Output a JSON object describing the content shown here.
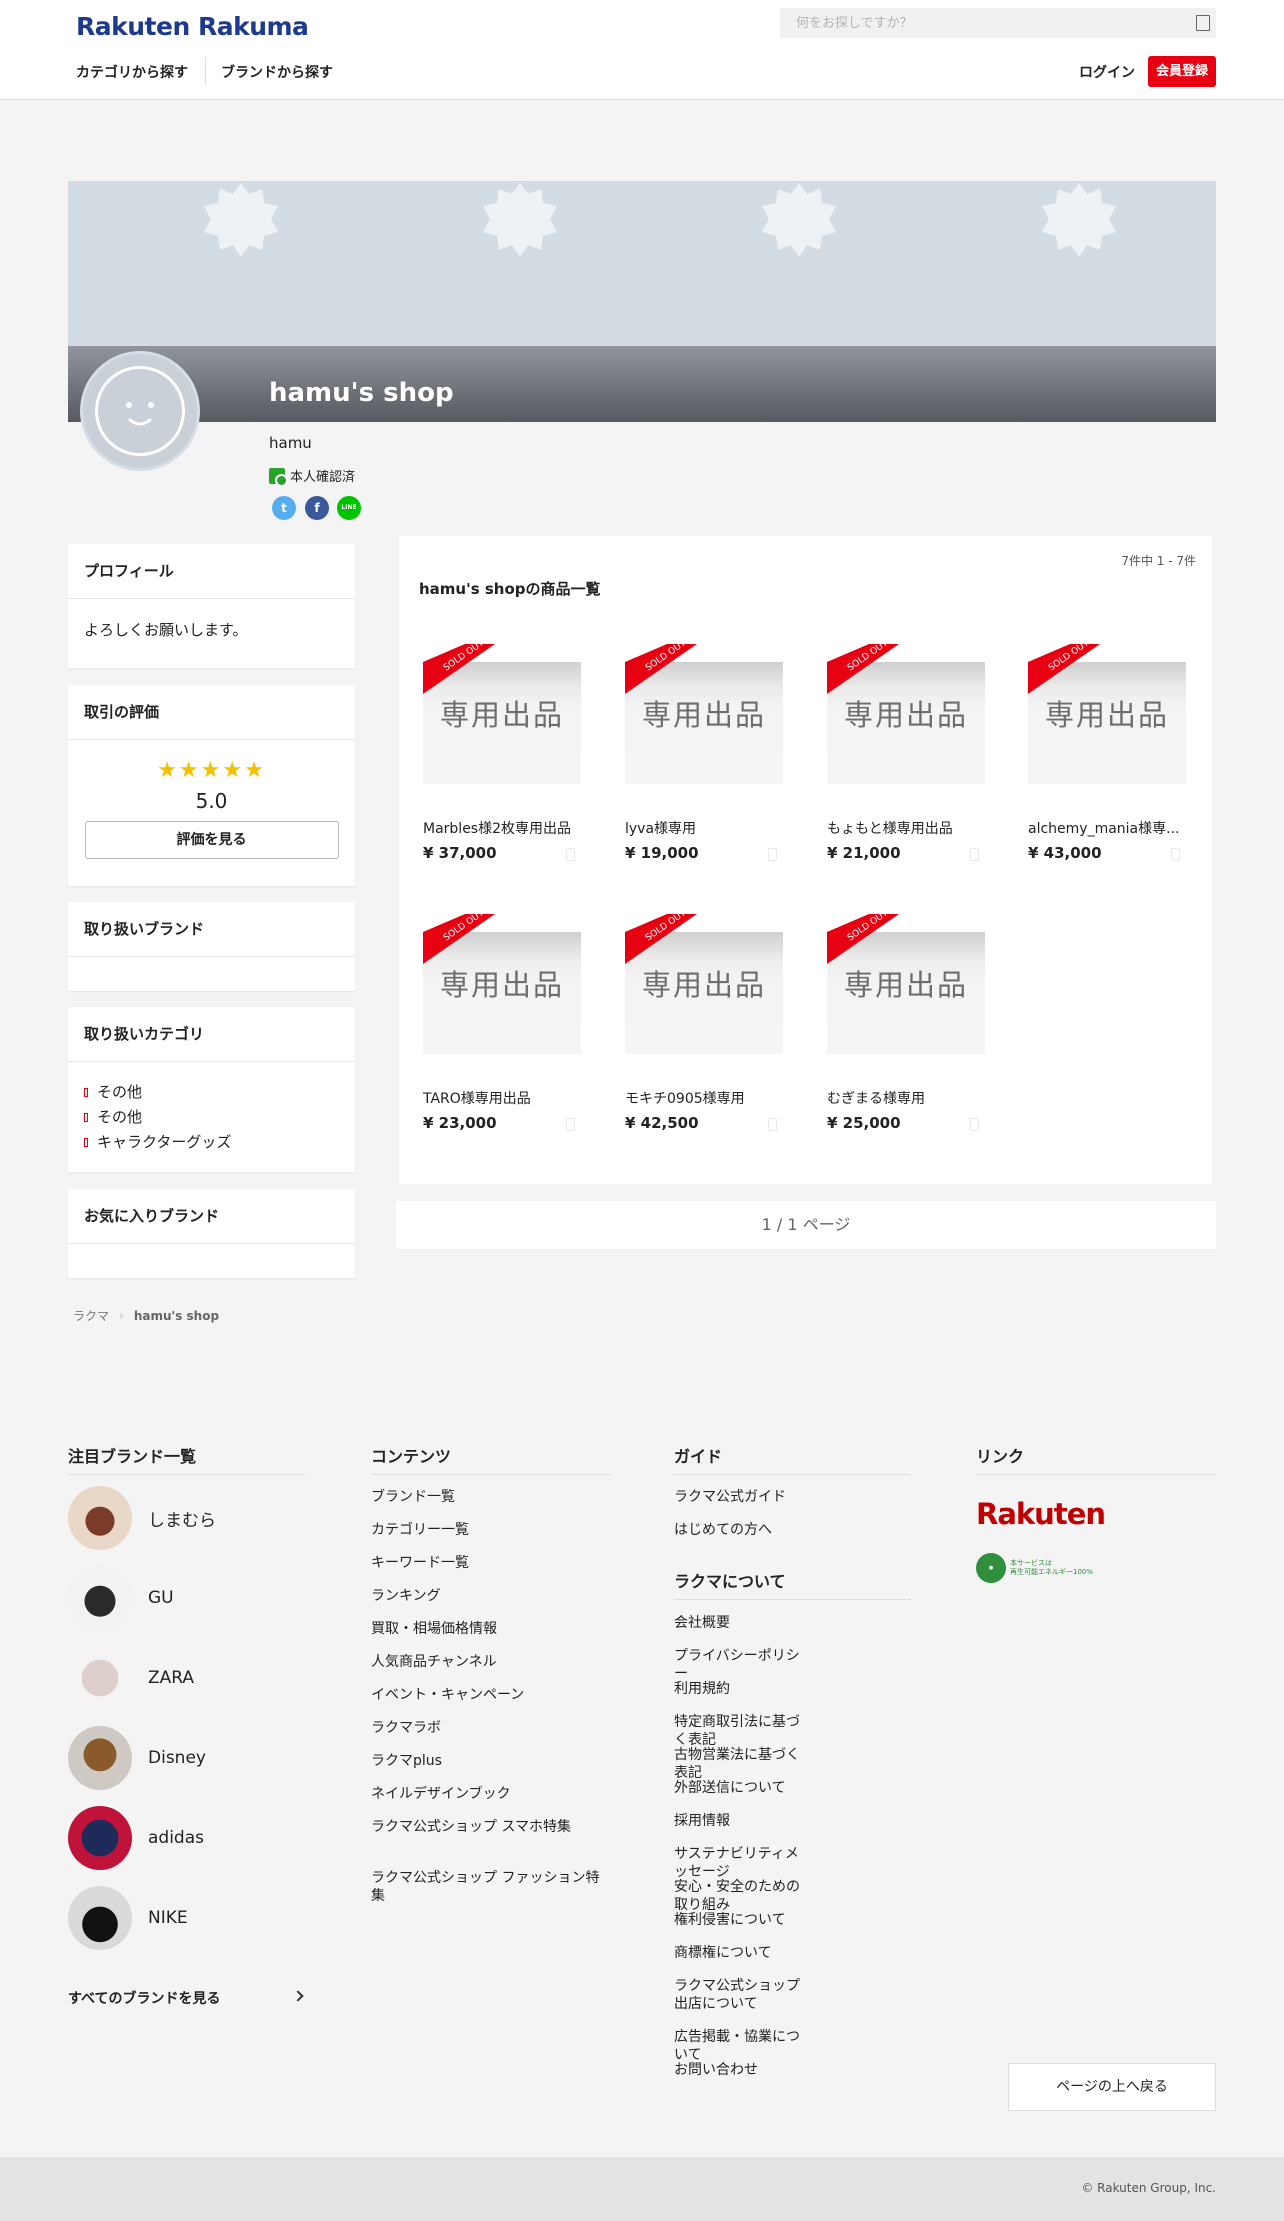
{
  "header": {
    "logo": "Rakuten Rakuma",
    "search_placeholder": "何をお探しですか？",
    "nav_category": "カテゴリから探す",
    "nav_brand": "ブランドから探す",
    "login": "ログイン",
    "register": "会員登録"
  },
  "shop": {
    "title": "hamu's shop",
    "owner": "hamu",
    "verified": "本人確認済"
  },
  "social": {
    "twitter": "t",
    "facebook": "f",
    "line": "LINE"
  },
  "sidebar": {
    "profile_title": "プロフィール",
    "profile_text": "よろしくお願いします。",
    "rating_title": "取引の評価",
    "rating_stars": "★★★★★",
    "rating_value": "5.0",
    "rating_button": "評価を見る",
    "brands_title": "取り扱いブランド",
    "categories_title": "取り扱いカテゴリ",
    "categories": [
      "その他",
      "その他",
      "キャラクターグッズ"
    ],
    "fav_brands_title": "お気に入りブランド"
  },
  "products": {
    "count": "7件中 1 - 7件",
    "heading": "hamu's shopの商品一覧",
    "ribbon": "SOLD OUT",
    "thumb_text": "専用出品",
    "items": [
      {
        "name": "Marbles様2枚専用出品",
        "price": "¥ 37,000"
      },
      {
        "name": "lyva様専用",
        "price": "¥ 19,000"
      },
      {
        "name": "もょもと様専用出品",
        "price": "¥ 21,000"
      },
      {
        "name": "alchemy_mania様専...",
        "price": "¥ 43,000"
      },
      {
        "name": "TARO様専用出品",
        "price": "¥ 23,000"
      },
      {
        "name": "モキチ0905様専用",
        "price": "¥ 42,500"
      },
      {
        "name": "むぎまる様専用",
        "price": "¥ 25,000"
      }
    ]
  },
  "pager": "1 / 1 ページ",
  "breadcrumb": {
    "home": "ラクマ",
    "current": "hamu's shop"
  },
  "footer": {
    "brands_title": "注目ブランド一覧",
    "brands": [
      "しまむら",
      "GU",
      "ZARA",
      "Disney",
      "adidas",
      "NIKE"
    ],
    "all_brands": "すべてのブランドを見る",
    "contents_title": "コンテンツ",
    "contents": [
      "ブランド一覧",
      "カテゴリー一覧",
      "キーワード一覧",
      "ランキング",
      "買取・相場価格情報",
      "人気商品チャンネル",
      "イベント・キャンペーン",
      "ラクマラボ",
      "ラクマplus",
      "ネイルデザインブック",
      "ラクマ公式ショップ スマホ特集",
      "ラクマ公式ショップ ファッション特集"
    ],
    "guide_title": "ガイド",
    "guide": [
      "ラクマ公式ガイド",
      "はじめての方へ"
    ],
    "about_title": "ラクマについて",
    "about": [
      "会社概要",
      "プライバシーポリシー",
      "利用規約",
      "特定商取引法に基づく表記",
      "古物営業法に基づく表記",
      "外部送信について",
      "採用情報",
      "サステナビリティメッセージ",
      "安心・安全のための取り組み",
      "権利侵害について",
      "商標権について",
      "ラクマ公式ショップ出店について",
      "広告掲載・協業について",
      "お問い合わせ"
    ],
    "links_title": "リンク",
    "rakuten_logo": "Rakuten",
    "green_badge_line1": "本サービスは",
    "green_badge_line2": "再生可能エネルギー100%",
    "to_top": "ページの上へ戻る",
    "copyright": "© Rakuten Group, Inc."
  }
}
